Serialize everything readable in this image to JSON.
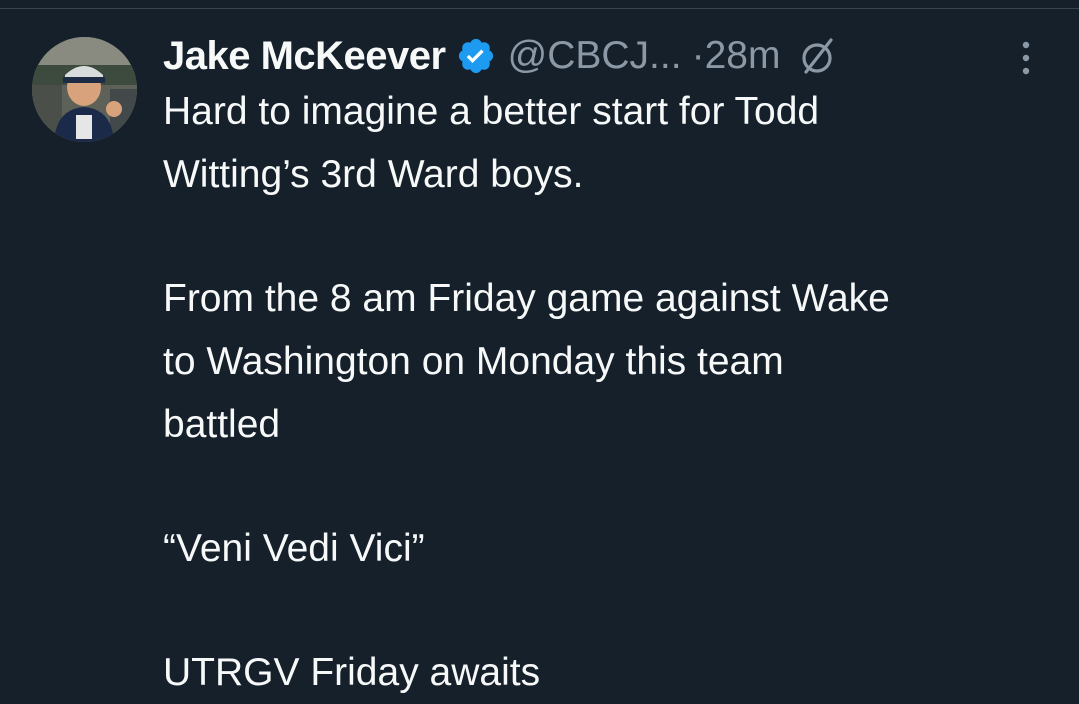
{
  "author": {
    "display_name": "Jake McKeever",
    "handle": "@CBCJ...",
    "separator": "·",
    "time": "28m",
    "avatar_icon": "profile-photo",
    "verified_icon": "verified-badge-icon",
    "edited_icon": "edited-icon",
    "more_icon": "more-options-icon"
  },
  "tweet": {
    "paragraphs": [
      [
        "Hard to imagine a better start for Todd",
        "Witting’s 3rd Ward boys."
      ],
      [
        "From the 8 am Friday game against Wake",
        "to Washington on Monday this team",
        "battled"
      ],
      [
        "“Veni Vedi Vici”"
      ],
      [
        "UTRGV Friday awaits"
      ]
    ]
  },
  "colors": {
    "background": "#15202b",
    "primary_text": "#f7f9f9",
    "secondary_text": "#8b98a5",
    "verified_blue": "#1d9bf0",
    "divider": "#38444d"
  }
}
